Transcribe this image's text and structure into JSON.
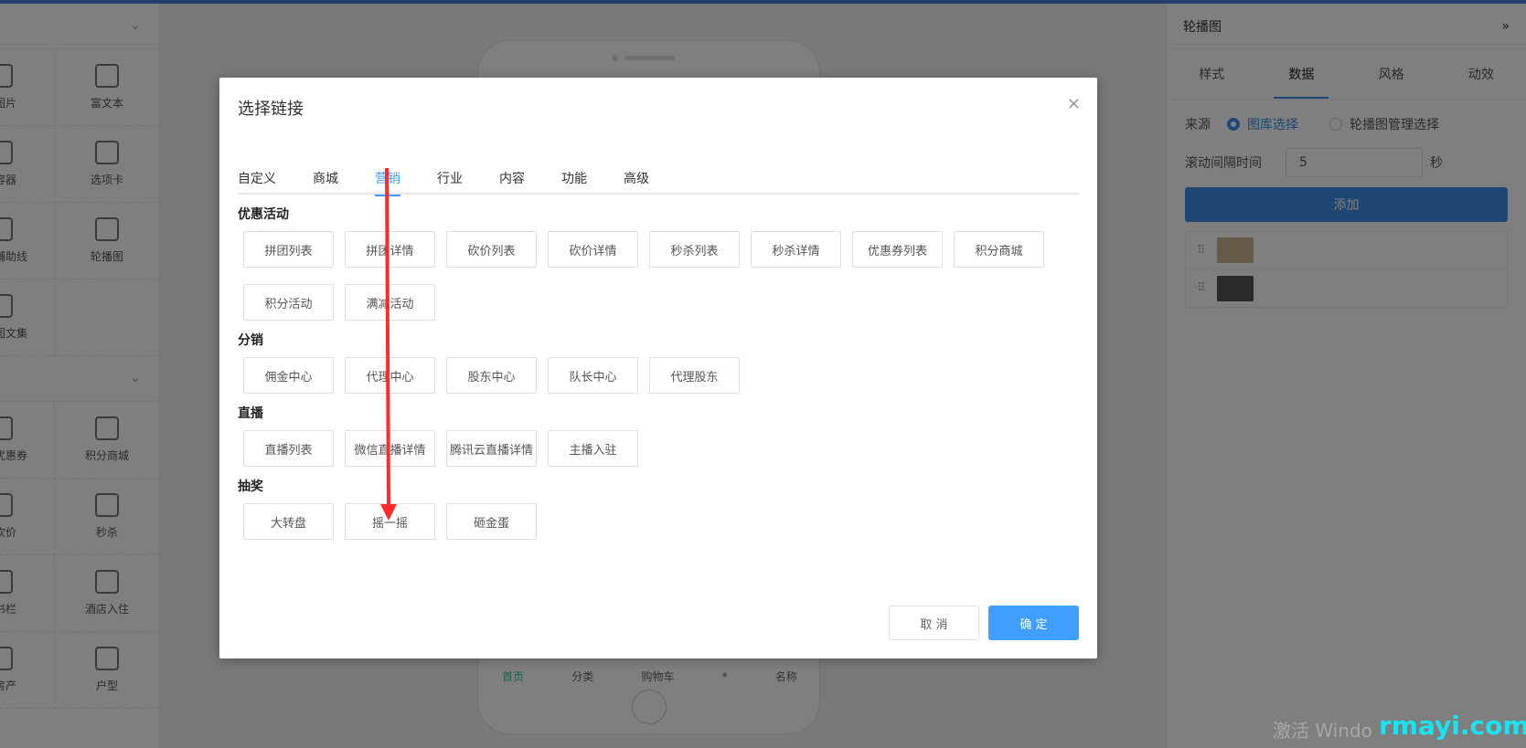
{
  "left_panel": {
    "group1": [
      {
        "label": "图片",
        "icon": "image-icon",
        "partial": true
      },
      {
        "label": "富文本",
        "icon": "text-icon"
      },
      {
        "label": "容器",
        "icon": "container-icon",
        "partial": true
      },
      {
        "label": "选项卡",
        "icon": "tab-icon"
      },
      {
        "label": "辅助线",
        "icon": "divider-icon",
        "partial": true
      },
      {
        "label": "轮播图",
        "icon": "carousel-icon"
      },
      {
        "label": "图文集",
        "icon": "grid-icon",
        "partial": true
      },
      {
        "label": "",
        "icon": ""
      }
    ],
    "group2": [
      {
        "label": "优惠券",
        "icon": "coupon-icon",
        "partial": true
      },
      {
        "label": "积分商城",
        "icon": "shop-icon"
      },
      {
        "label": "砍价",
        "icon": "tag-icon",
        "partial": true
      },
      {
        "label": "秒杀",
        "icon": "lightning-icon"
      },
      {
        "label": "书栏",
        "icon": "book-icon",
        "partial": true
      },
      {
        "label": "酒店入住",
        "icon": "hotel-icon"
      },
      {
        "label": "房产",
        "icon": "house-icon",
        "partial": true
      },
      {
        "label": "户型",
        "icon": "door-icon"
      }
    ]
  },
  "phone": {
    "tabbar": [
      "首页",
      "分类",
      "购物车",
      "*",
      "名称"
    ]
  },
  "right_panel": {
    "title": "轮播图",
    "collapse": "»",
    "tabs": [
      "样式",
      "数据",
      "风格",
      "动效"
    ],
    "active_tab": 1,
    "source_label": "来源",
    "source_options": [
      "图库选择",
      "轮播图管理选择"
    ],
    "interval_label": "滚动间隔时间",
    "interval_value": "5",
    "interval_unit": "秒",
    "add_button": "添加"
  },
  "dialog": {
    "title": "选择链接",
    "close": "×",
    "tabs": [
      "自定义",
      "商城",
      "营销",
      "行业",
      "内容",
      "功能",
      "高级"
    ],
    "active_tab": 2,
    "sections": [
      {
        "title": "优惠活动",
        "items": [
          "拼团列表",
          "拼团详情",
          "砍价列表",
          "砍价详情",
          "秒杀列表",
          "秒杀详情",
          "优惠券列表",
          "积分商城",
          "积分活动",
          "满减活动"
        ]
      },
      {
        "title": "分销",
        "items": [
          "佣金中心",
          "代理中心",
          "股东中心",
          "队长中心",
          "代理股东"
        ]
      },
      {
        "title": "直播",
        "items": [
          "直播列表",
          "微信直播详情",
          "腾讯云直播详情",
          "主播入驻"
        ]
      },
      {
        "title": "抽奖",
        "items": [
          "大转盘",
          "摇一摇",
          "砸金蛋"
        ]
      }
    ],
    "cancel": "取 消",
    "confirm": "确 定"
  },
  "watermark": {
    "windows": "激活 Windo",
    "site": "rmayi.com"
  },
  "colors": {
    "primary": "#409eff",
    "arrow": "#ff2a2a"
  }
}
